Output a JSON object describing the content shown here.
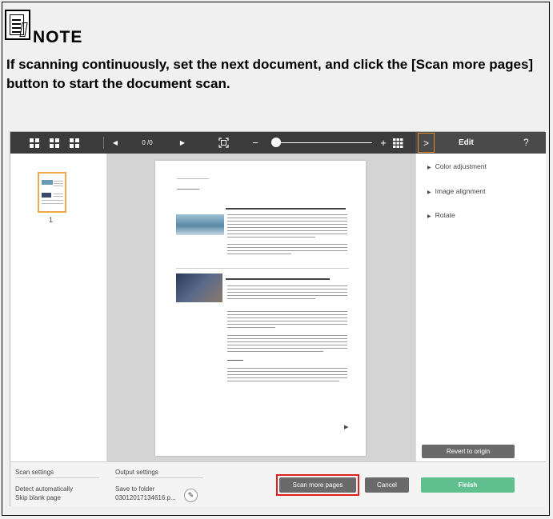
{
  "note": {
    "label": "NOTE",
    "text": "If scanning continuously, set the next document, and click the [Scan more pages] button to start the document scan."
  },
  "toolbar": {
    "page_counter": "0 /0",
    "zoom_out": "−",
    "zoom_in": "+",
    "icons": [
      "grid-view-icon",
      "grid-view-icon",
      "grid-view-icon",
      "prev-page-icon",
      "next-page-icon",
      "fit-page-icon",
      "zoom-out-icon",
      "zoom-slider",
      "zoom-in-icon",
      "thumbnail-grid-icon"
    ]
  },
  "thumbnails": {
    "items": [
      {
        "number": "1"
      }
    ]
  },
  "edit_panel": {
    "title": "Edit",
    "help": "?",
    "toggle": ">",
    "items": [
      "Color adjustment",
      "Image alignment",
      "Rotate"
    ],
    "revert_label": "Revert to origin"
  },
  "bottom": {
    "scan_settings_label": "Scan settings",
    "scan_detect": "Detect automatically",
    "scan_skip": "Skip blank page",
    "output_settings_label": "Output settings",
    "output_mode": "Save to folder",
    "output_file": "03012017134616.p...",
    "scan_more_label": "Scan more pages",
    "cancel_label": "Cancel",
    "finish_label": "Finish"
  },
  "colors": {
    "toolbar": "#3b3b3b",
    "accent_orange": "#f0a94a",
    "finish_green": "#5fbf8f",
    "highlight_red": "#e02020"
  }
}
